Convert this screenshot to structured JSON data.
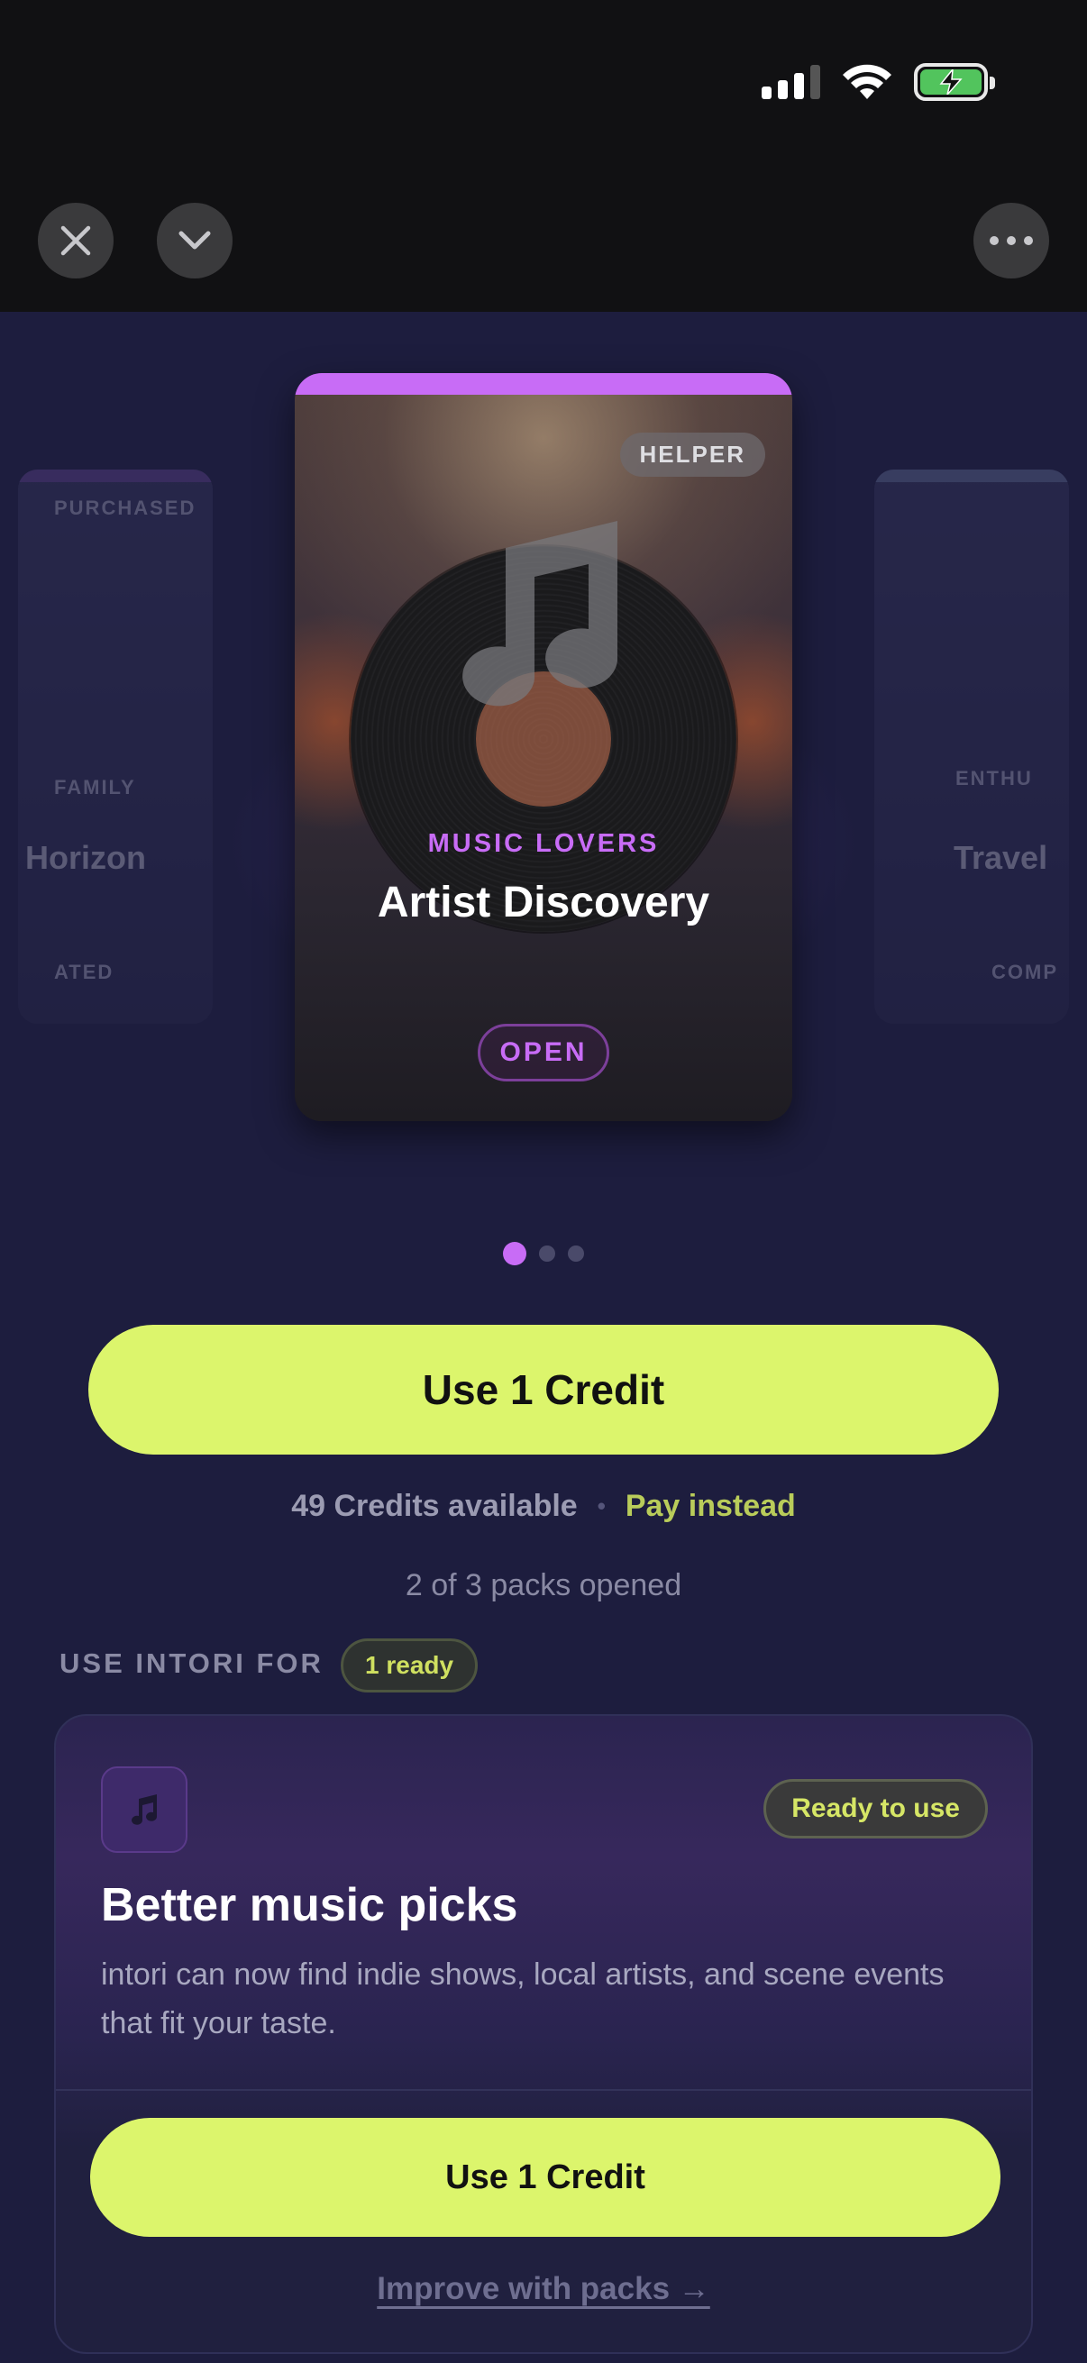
{
  "status_bar": {
    "signal_icon": "signal-icon",
    "wifi_icon": "wifi-icon",
    "battery_icon": "battery-charging-icon"
  },
  "nav": {
    "close_icon": "close-icon",
    "collapse_icon": "chevron-down-icon",
    "more_icon": "more-icon"
  },
  "carousel": {
    "left_card": {
      "badge": "PURCHASED",
      "category": "FAMILY",
      "title": "Horizon",
      "status": "ATED"
    },
    "right_card": {
      "category": "ENTHU",
      "title": "Travel",
      "status": "COMP"
    },
    "main_card": {
      "tag": "HELPER",
      "category": "MUSIC LOVERS",
      "title": "Artist Discovery",
      "action": "OPEN",
      "accent_color": "#c86cf6",
      "image_icon": "music-note-icon"
    },
    "pages": 3,
    "active_page": 1
  },
  "primary_cta": {
    "label": "Use 1 Credit",
    "color": "#dcf56c"
  },
  "credits": {
    "available": "49 Credits available",
    "separator": "•",
    "pay_instead": "Pay instead"
  },
  "packs_status": "2 of 3 packs opened",
  "use_section": {
    "label": "USE INTORI FOR",
    "ready_count": "1 ready",
    "card": {
      "icon": "music-note-icon",
      "badge": "Ready to use",
      "title": "Better music picks",
      "description": "intori can now find indie shows, local artists, and scene events that fit your taste.",
      "button": "Use 1 Credit",
      "link": "Improve with packs →"
    }
  }
}
